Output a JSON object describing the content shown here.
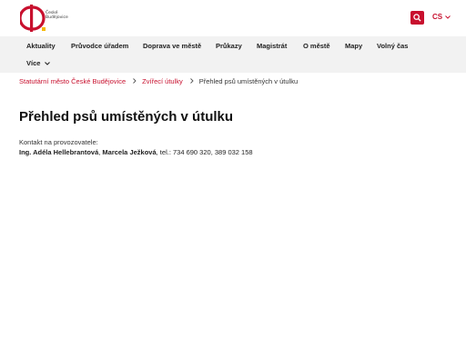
{
  "header": {
    "logo_lines": [
      "České",
      "Budějovice"
    ],
    "lang": "CS",
    "accent_color": "#c8102e"
  },
  "nav": {
    "items": [
      "Aktuality",
      "Průvodce úřadem",
      "Doprava ve městě",
      "Průkazy",
      "Magistrát",
      "O městě",
      "Mapy",
      "Volný čas"
    ],
    "more": "Více"
  },
  "breadcrumb": {
    "items": [
      "Statutární město České Budějovice",
      "Zvířecí útulky"
    ],
    "current": "Přehled psů umístěných v útulku"
  },
  "main": {
    "title": "Přehled psů umístěných v útulku",
    "contact_label": "Kontakt na provozovatele:",
    "contact_name1": "Ing. Adéla Hellebrantová",
    "contact_sep": ", ",
    "contact_name2": "Marcela Ježková",
    "contact_phone": ", tel.: 734 690 320, 389 032 158"
  }
}
